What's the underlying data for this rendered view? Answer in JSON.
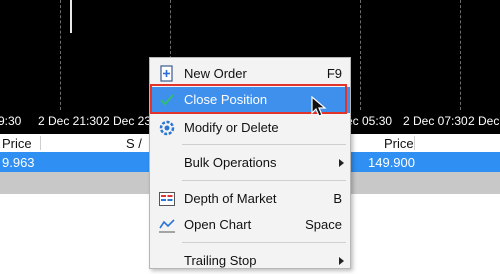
{
  "chart": {
    "time_labels": [
      "9:30",
      "2 Dec 21:30",
      "2 Dec 23",
      "ec 05:30",
      "2 Dec 07:30",
      "2 Dec"
    ]
  },
  "table": {
    "headers": [
      "Price",
      "S /",
      "Price"
    ],
    "selected_row": {
      "price_left": "9.963",
      "price_right": "149.900"
    }
  },
  "context_menu": {
    "items": [
      {
        "label": "New Order",
        "shortcut": "F9",
        "icon": "new-order-icon"
      },
      {
        "label": "Close Position",
        "shortcut": "",
        "icon": "checkmark-icon",
        "highlighted": true
      },
      {
        "label": "Modify or Delete",
        "shortcut": "",
        "icon": "gear-icon"
      },
      {
        "label": "Bulk Operations",
        "shortcut": "",
        "has_submenu": true
      },
      {
        "label": "Depth of Market",
        "shortcut": "B",
        "icon": "depth-of-market-icon"
      },
      {
        "label": "Open Chart",
        "shortcut": "Space",
        "icon": "chart-line-icon"
      },
      {
        "label": "Trailing Stop",
        "shortcut": "",
        "has_submenu": true
      }
    ]
  },
  "colors": {
    "highlight": "#3f8fed",
    "annotation_border": "#e2332d",
    "selected_row": "#2f8ff2"
  }
}
